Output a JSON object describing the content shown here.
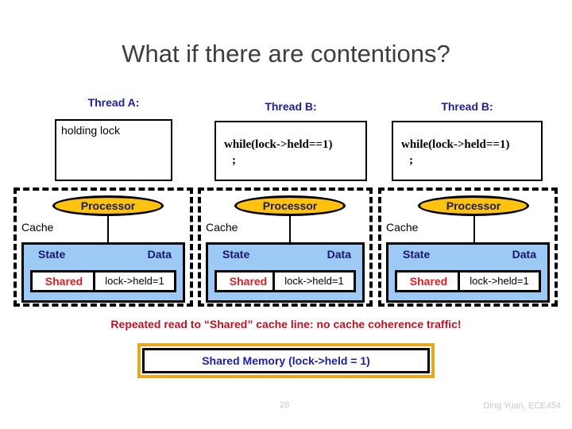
{
  "slide": {
    "title": "What if there are contentions?",
    "caption": "Repeated read to “Shared” cache line: no cache coherence traffic!"
  },
  "threads": [
    {
      "label": "Thread A:",
      "code": "holding lock",
      "code_style": "plain"
    },
    {
      "label": "Thread B:",
      "code_line1": "while(lock->held==1)",
      "code_line2": ";",
      "code_style": "serif"
    },
    {
      "label": "Thread B:",
      "code_line1": "while(lock->held==1)",
      "code_line2": ";",
      "code_style": "serif"
    }
  ],
  "panels": [
    {
      "processor_label": "Processor",
      "cache_label": "Cache",
      "state_header": "State",
      "data_header": "Data",
      "state_value": "Shared",
      "data_value": "lock->held=1"
    },
    {
      "processor_label": "Processor",
      "cache_label": "Cache",
      "state_header": "State",
      "data_header": "Data",
      "state_value": "Shared",
      "data_value": "lock->held=1"
    },
    {
      "processor_label": "Processor",
      "cache_label": "Cache",
      "state_header": "State",
      "data_header": "Data",
      "state_value": "Shared",
      "data_value": "lock->held=1"
    }
  ],
  "shared_memory": {
    "text": "Shared Memory (lock->held = 1)"
  },
  "footer": {
    "page_number": "26",
    "credit": "Ding Yuan, ECE454"
  },
  "colors": {
    "title": "#3d3d3d",
    "thread_label": "#1f1f8f",
    "processor_fill": "#FFC20E",
    "cache_fill": "#9DC9F5",
    "state_value": "#d81f26",
    "caption": "#b81425",
    "shared_memory_border": "#E8A81C",
    "shared_memory_text": "#1f1f9e",
    "footer": "#c8c8c8"
  }
}
